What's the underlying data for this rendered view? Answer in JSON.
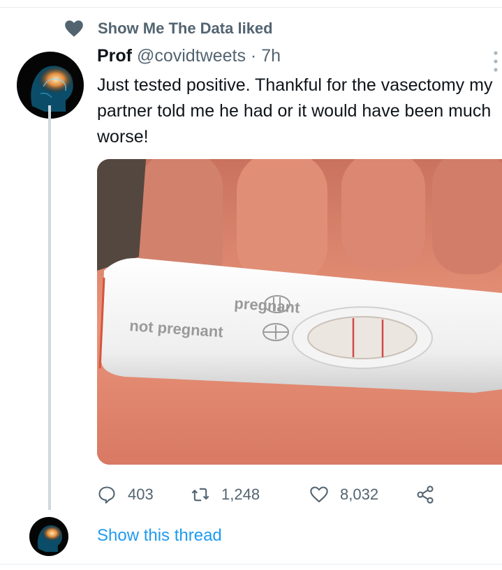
{
  "social_context": {
    "text": "Show Me The Data liked",
    "icon": "heart-icon"
  },
  "tweet": {
    "display_name": "Prof",
    "handle": "@covidtweets",
    "separator": "·",
    "time": "7h",
    "text": "Just tested positive. Thankful for the vasectomy my partner told me he had or it would have been much worse!",
    "media": {
      "label_pregnant": "pregnant",
      "label_not_pregnant": "not pregnant"
    },
    "actions": {
      "replies": "403",
      "retweets": "1,248",
      "likes": "8,032"
    },
    "show_thread": "Show this thread"
  },
  "colors": {
    "link_blue": "#1d9bf0",
    "secondary_text": "#536471",
    "thread_line": "#cfd9de"
  }
}
